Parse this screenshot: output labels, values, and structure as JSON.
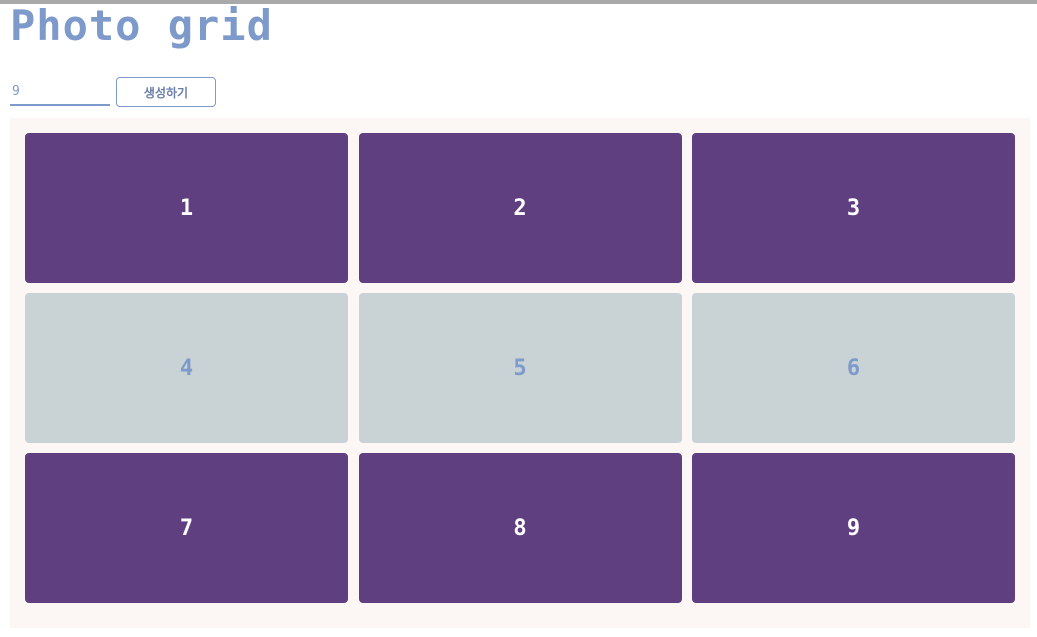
{
  "page": {
    "title": "Photo grid"
  },
  "controls": {
    "count_value": "9",
    "generate_label": "생성하기"
  },
  "colors": {
    "accent": "#7d9acb",
    "cell_dark": "#5f3f80",
    "cell_light": "#c9d3d6",
    "panel_bg": "#fcf6f4"
  },
  "grid": {
    "cells": [
      {
        "label": "1",
        "tone": "dark"
      },
      {
        "label": "2",
        "tone": "dark"
      },
      {
        "label": "3",
        "tone": "dark"
      },
      {
        "label": "4",
        "tone": "light"
      },
      {
        "label": "5",
        "tone": "light"
      },
      {
        "label": "6",
        "tone": "light"
      },
      {
        "label": "7",
        "tone": "dark"
      },
      {
        "label": "8",
        "tone": "dark"
      },
      {
        "label": "9",
        "tone": "dark"
      }
    ]
  }
}
